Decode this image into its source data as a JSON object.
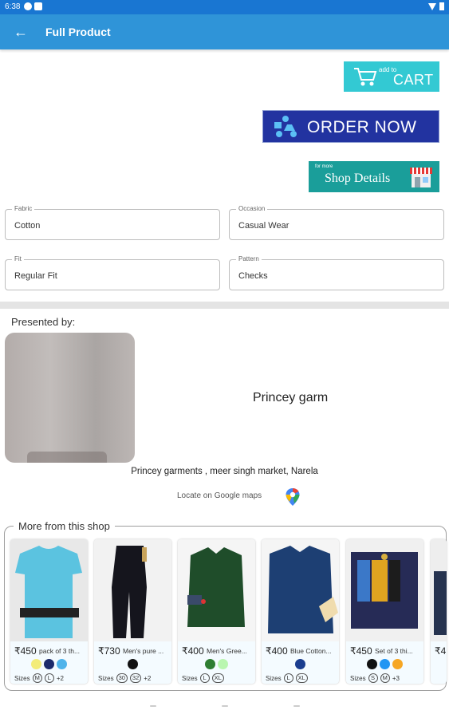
{
  "status_bar": {
    "time": "6:38"
  },
  "app_bar": {
    "title": "Full Product"
  },
  "actions": {
    "cart_small": "add to",
    "cart_label": "CART",
    "order_label": "ORDER NOW",
    "shop_small": "for more",
    "shop_label": "Shop Details"
  },
  "attributes": [
    {
      "label": "Fabric",
      "value": "Cotton"
    },
    {
      "label": "Occasion",
      "value": "Casual Wear"
    },
    {
      "label": "Fit",
      "value": "Regular Fit"
    },
    {
      "label": "Pattern",
      "value": "Checks"
    }
  ],
  "presented_by": {
    "heading": "Presented by:",
    "shop_name": "Princey garm",
    "address": "Princey garments , meer singh market, Narela",
    "locate_label": "Locate on Google maps"
  },
  "more_from_shop": {
    "title": "More from this shop",
    "sizes_label": "Sizes",
    "products": [
      {
        "price": "₹450",
        "name": "pack of 3 th...",
        "colors": [
          "#f3ec7a",
          "#1c2a6b",
          "#4fb3ea"
        ],
        "sizes": [
          "M",
          "L"
        ],
        "more": "+2"
      },
      {
        "price": "₹730",
        "name": "Men's pure ...",
        "colors": [
          "#111111"
        ],
        "sizes": [
          "30",
          "32"
        ],
        "more": "+2"
      },
      {
        "price": "₹400",
        "name": "Men's Gree...",
        "colors": [
          "#2e7d32",
          "#b9f6b0"
        ],
        "sizes": [
          "L",
          "XL"
        ],
        "more": ""
      },
      {
        "price": "₹400",
        "name": "Blue Cotton...",
        "colors": [
          "#1a3d8f"
        ],
        "sizes": [
          "L",
          "XL"
        ],
        "more": ""
      },
      {
        "price": "₹450",
        "name": "Set of 3 thi...",
        "colors": [
          "#111111",
          "#2196f3",
          "#f6a623"
        ],
        "sizes": [
          "S",
          "M"
        ],
        "more": "+3"
      },
      {
        "price": "₹4",
        "name": "",
        "colors": [],
        "sizes": [],
        "more": ""
      }
    ]
  }
}
